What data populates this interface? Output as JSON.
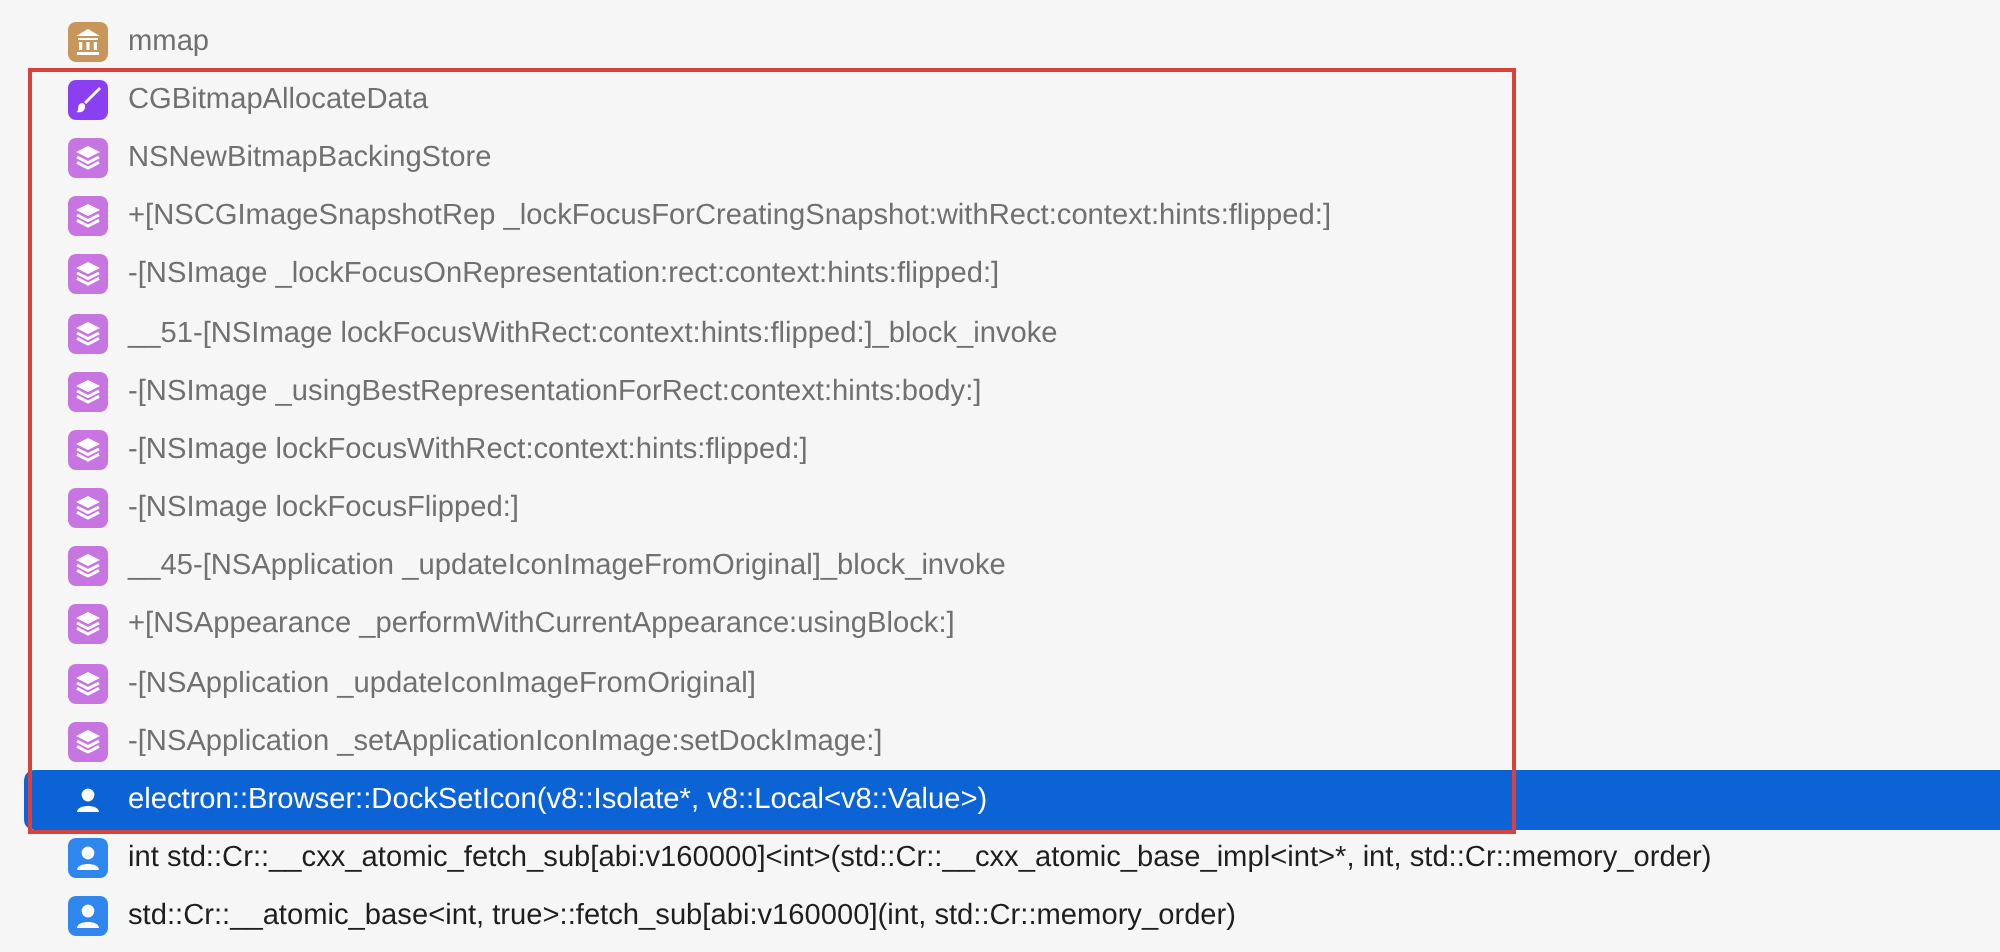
{
  "frames": [
    {
      "kind": "library",
      "name": "mmap",
      "selected": false,
      "annotated": false
    },
    {
      "kind": "graphics",
      "name": "CGBitmapAllocateData",
      "selected": false,
      "annotated": true
    },
    {
      "kind": "framework",
      "name": "NSNewBitmapBackingStore",
      "selected": false,
      "annotated": true
    },
    {
      "kind": "framework",
      "name": "+[NSCGImageSnapshotRep _lockFocusForCreatingSnapshot:withRect:context:hints:flipped:]",
      "selected": false,
      "annotated": true
    },
    {
      "kind": "framework",
      "name": "-[NSImage _lockFocusOnRepresentation:rect:context:hints:flipped:]",
      "selected": false,
      "annotated": true
    },
    {
      "kind": "framework",
      "name": "__51-[NSImage lockFocusWithRect:context:hints:flipped:]_block_invoke",
      "selected": false,
      "annotated": true
    },
    {
      "kind": "framework",
      "name": "-[NSImage _usingBestRepresentationForRect:context:hints:body:]",
      "selected": false,
      "annotated": true
    },
    {
      "kind": "framework",
      "name": "-[NSImage lockFocusWithRect:context:hints:flipped:]",
      "selected": false,
      "annotated": true
    },
    {
      "kind": "framework",
      "name": "-[NSImage lockFocusFlipped:]",
      "selected": false,
      "annotated": true
    },
    {
      "kind": "framework",
      "name": "__45-[NSApplication _updateIconImageFromOriginal]_block_invoke",
      "selected": false,
      "annotated": true
    },
    {
      "kind": "framework",
      "name": "+[NSAppearance _performWithCurrentAppearance:usingBlock:]",
      "selected": false,
      "annotated": true
    },
    {
      "kind": "framework",
      "name": "-[NSApplication _updateIconImageFromOriginal]",
      "selected": false,
      "annotated": true
    },
    {
      "kind": "framework",
      "name": "-[NSApplication _setApplicationIconImage:setDockImage:]",
      "selected": false,
      "annotated": true
    },
    {
      "kind": "user",
      "name": "electron::Browser::DockSetIcon(v8::Isolate*, v8::Local<v8::Value>)",
      "selected": true,
      "annotated": true
    },
    {
      "kind": "user",
      "name": "int std::Cr::__cxx_atomic_fetch_sub[abi:v160000]<int>(std::Cr::__cxx_atomic_base_impl<int>*, int, std::Cr::memory_order)",
      "selected": false,
      "annotated": false
    },
    {
      "kind": "user",
      "name": "std::Cr::__atomic_base<int, true>::fetch_sub[abi:v160000](int, std::Cr::memory_order)",
      "selected": false,
      "annotated": false
    }
  ]
}
